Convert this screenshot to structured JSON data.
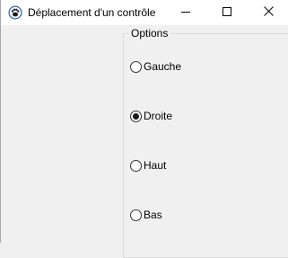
{
  "window": {
    "title": "Déplacement d'un contrôle",
    "icon": "paw-icon"
  },
  "caption_buttons": {
    "minimize": "minimize-icon",
    "maximize": "maximize-icon",
    "close": "close-icon"
  },
  "options_group": {
    "legend": "Options",
    "items": [
      {
        "label": "Gauche",
        "checked": false
      },
      {
        "label": "Droite",
        "checked": true
      },
      {
        "label": "Haut",
        "checked": false
      },
      {
        "label": "Bas",
        "checked": false
      }
    ]
  },
  "colors": {
    "titlebar_bg": "#ffffff",
    "window_bg": "#f0f0f0",
    "icon_blue": "#1f5fbf"
  }
}
